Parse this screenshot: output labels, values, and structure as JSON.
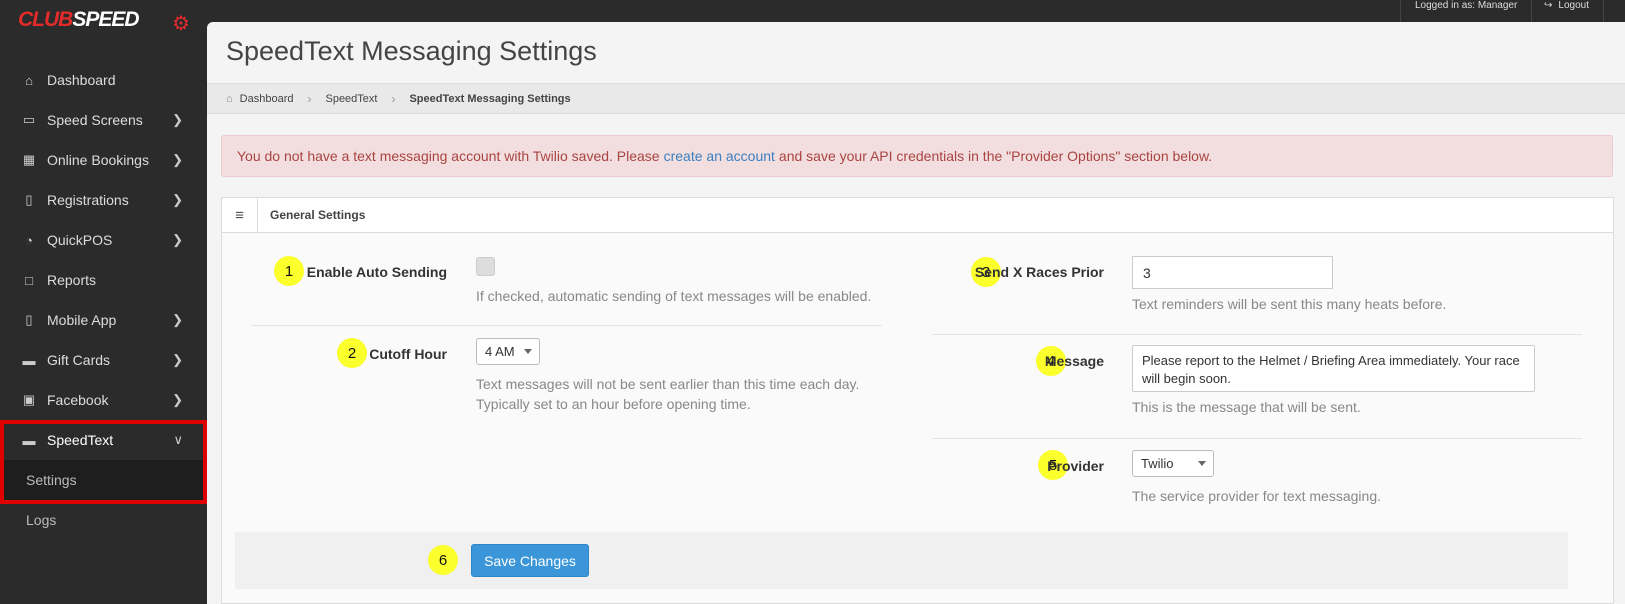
{
  "brand": {
    "logo_text_red": "CLUB",
    "logo_text_white": "SPEED",
    "logo_icon": "gear-icon",
    "accent_red": "#e32b2b"
  },
  "topbar": {
    "logged_in": "Logged in as: Manager",
    "logout": "Logout",
    "logout_icon": "sign-out-icon"
  },
  "sidebar": {
    "items": [
      {
        "label": "Dashboard",
        "icon": "home-icon",
        "has_submenu": false
      },
      {
        "label": "Speed Screens",
        "icon": "monitor-icon",
        "has_submenu": true
      },
      {
        "label": "Online Bookings",
        "icon": "calendar-icon",
        "has_submenu": true
      },
      {
        "label": "Registrations",
        "icon": "tablet-icon",
        "has_submenu": true
      },
      {
        "label": "QuickPOS",
        "icon": "dashboard-gauge-icon",
        "has_submenu": true
      },
      {
        "label": "Reports",
        "icon": "file-icon",
        "has_submenu": false
      },
      {
        "label": "Mobile App",
        "icon": "mobile-icon",
        "has_submenu": true
      },
      {
        "label": "Gift Cards",
        "icon": "credit-card-icon",
        "has_submenu": true
      },
      {
        "label": "Facebook",
        "icon": "facebook-icon",
        "has_submenu": true
      },
      {
        "label": "SpeedText",
        "icon": "comments-icon",
        "has_submenu": true,
        "expanded": true
      }
    ],
    "sub_items": [
      {
        "label": "Settings",
        "current": true
      },
      {
        "label": "Logs",
        "current": false
      }
    ]
  },
  "page": {
    "title": "SpeedText Messaging Settings"
  },
  "breadcrumb": {
    "items": [
      "Dashboard",
      "SpeedText",
      "SpeedText Messaging Settings"
    ]
  },
  "alert": {
    "before": "You do not have a text messaging account with Twilio saved. Please",
    "link": "create an account",
    "after": "and save your API credentials in the \"Provider Options\" section below."
  },
  "panel": {
    "title": "General Settings"
  },
  "fields": {
    "enable_auto_sending": {
      "badge": "1",
      "label": "Enable Auto Sending",
      "checked": false,
      "help": "If checked, automatic sending of text messages will be enabled."
    },
    "cutoff_hour": {
      "badge": "2",
      "label": "Cutoff Hour",
      "value": "4 AM",
      "help_line1": "Text messages will not be sent earlier than this time each day.",
      "help_line2": "Typically set to an hour before opening time."
    },
    "send_x_races_prior": {
      "badge": "3",
      "label": "Send X Races Prior",
      "value": "3",
      "help": "Text reminders will be sent this many heats before."
    },
    "message": {
      "badge": "4",
      "label": "Message",
      "value": "Please report to the Helmet / Briefing Area immediately. Your race will begin soon.",
      "help": "This is the message that will be sent."
    },
    "provider": {
      "badge": "5",
      "label": "Provider",
      "value": "Twilio",
      "help": "The service provider for text messaging."
    }
  },
  "actions": {
    "save_badge": "6",
    "save_label": "Save Changes",
    "save_color": "#3a96d8"
  },
  "colors": {
    "annotation_badge": "#fbff2b",
    "highlight_box": "#e00000",
    "alert_bg": "#f2dede",
    "alert_text": "#a94442"
  }
}
